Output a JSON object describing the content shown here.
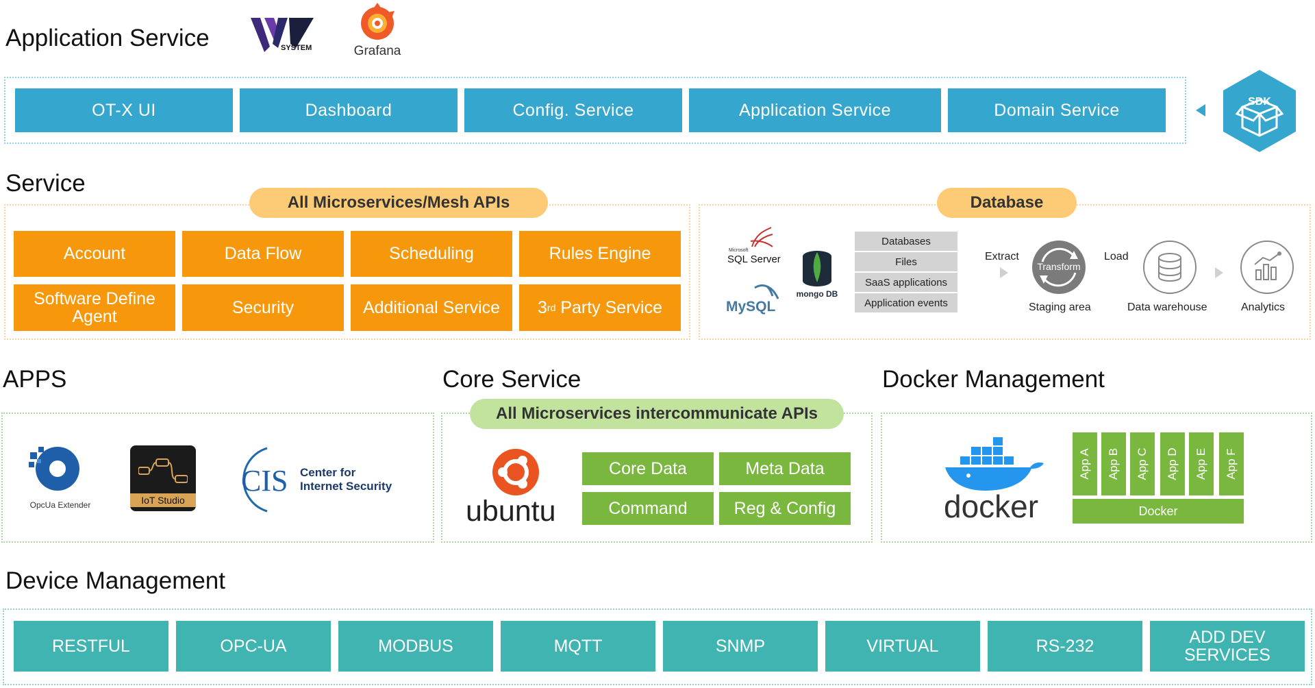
{
  "application_service": {
    "title": "Application Service",
    "logos": {
      "vw_logo_text": "SYSTEM",
      "grafana": "Grafana"
    },
    "buttons": [
      "OT-X UI",
      "Dashboard",
      "Config. Service",
      "Application Service",
      "Domain Service"
    ],
    "sdk": "SDK"
  },
  "service": {
    "title": "Service",
    "pill": "All Microservices/Mesh APIs",
    "grid": [
      "Account",
      "Data Flow",
      "Scheduling",
      "Rules Engine",
      "Software Define Agent",
      "Security",
      "Additional Service"
    ],
    "third_party": {
      "prefix": "3",
      "sup": "rd",
      "suffix": " Party Service"
    }
  },
  "database": {
    "pill": "Database",
    "sources": [
      "SQL Server",
      "mongo DB",
      "MySQL"
    ],
    "sql_server_small": "Microsoft",
    "rows": [
      "Databases",
      "Files",
      "SaaS applications",
      "Application events"
    ],
    "extract": "Extract",
    "load": "Load",
    "transform": "Transform",
    "staging": "Staging area",
    "warehouse": "Data warehouse",
    "analytics": "Analytics"
  },
  "apps": {
    "title": "APPS",
    "opcua": "OpcUa Extender",
    "iot": "IoT Studio",
    "cis_big": "CIS",
    "cis_line1": "Center for",
    "cis_line2": "Internet Security"
  },
  "core_service": {
    "title": "Core Service",
    "pill": "All Microservices intercommunicate APIs",
    "ubuntu": "ubuntu",
    "grid": [
      "Core Data",
      "Meta Data",
      "Command",
      "Reg & Config"
    ]
  },
  "docker_management": {
    "title": "Docker Management",
    "docker_logo": "docker",
    "apps": [
      "App A",
      "App B",
      "App C",
      "App D",
      "App E",
      "App F"
    ],
    "docker_bar": "Docker"
  },
  "device_management": {
    "title": "Device Management",
    "buttons": [
      "RESTFUL",
      "OPC-UA",
      "MODBUS",
      "MQTT",
      "SNMP",
      "VIRTUAL",
      "RS-232",
      "ADD DEV SERVICES"
    ]
  },
  "colors": {
    "blue": "#35a7cf",
    "orange": "#f7980c",
    "green": "#79b73f",
    "teal": "#3fb4b1",
    "pill_orange": "#fdca76",
    "pill_green": "#c2e39e"
  }
}
